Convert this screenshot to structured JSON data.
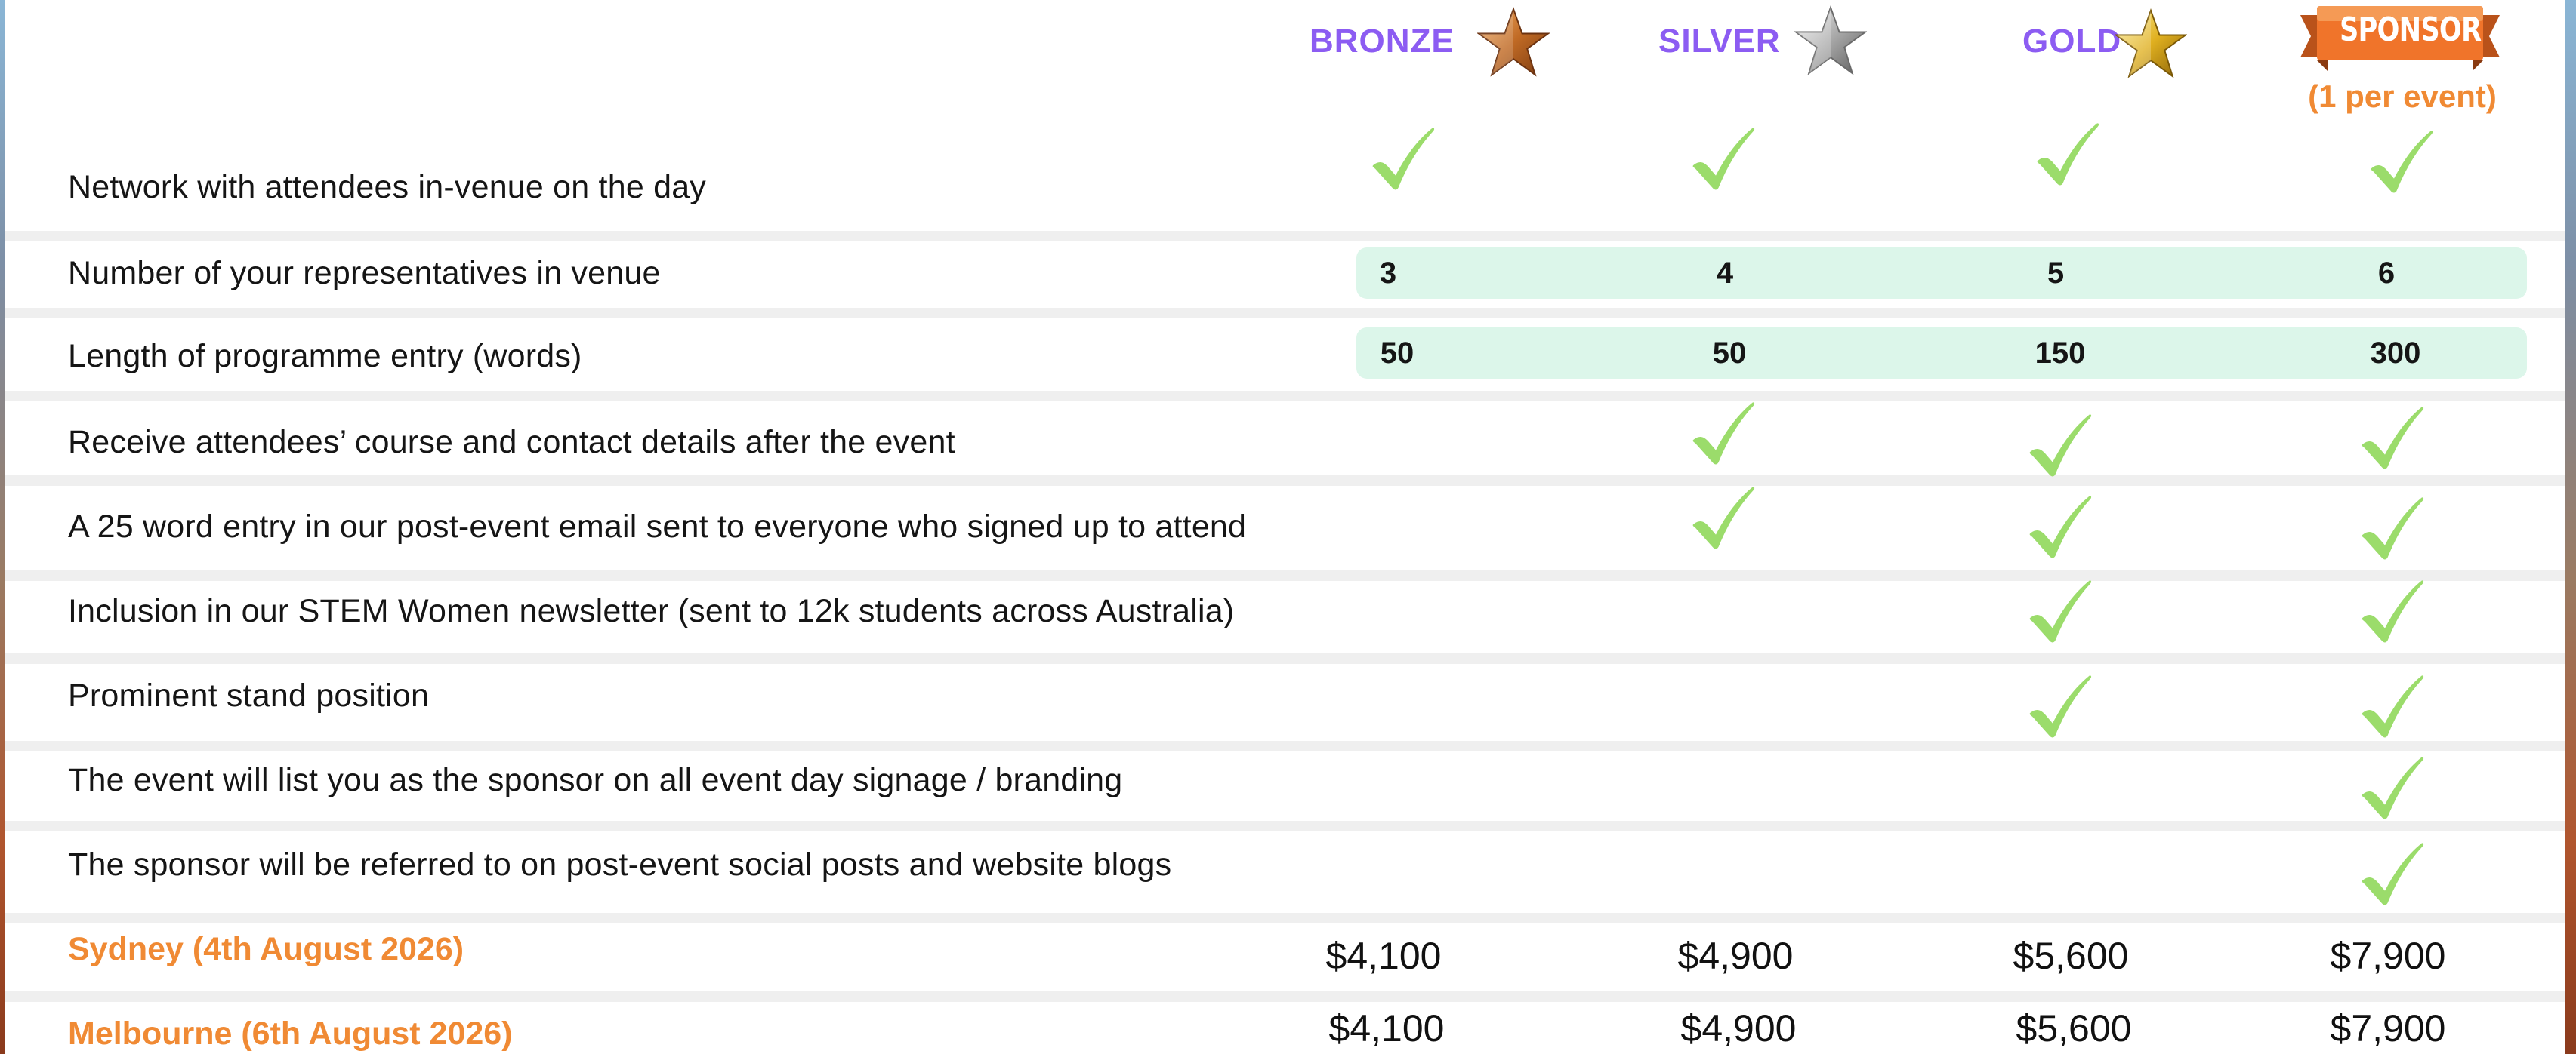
{
  "tiers": {
    "bronze": "BRONZE",
    "silver": "SILVER",
    "gold": "GOLD",
    "sponsor": "SPONSOR",
    "sponsor_note": "(1 per event)"
  },
  "features": [
    "Network with attendees in-venue on the day",
    "Number of your representatives in venue",
    "Length of programme entry (words)",
    "Receive attendees’ course and contact details after the event",
    "A 25 word entry in our post-event email sent to everyone who signed up to attend",
    "Inclusion in our STEM Women newsletter (sent to 12k students across Australia)",
    "Prominent stand position",
    "The event will list you as the sponsor on all event day signage / branding",
    "The sponsor will be referred to on post-event social posts and website blogs"
  ],
  "representatives": [
    "3",
    "4",
    "5",
    "6"
  ],
  "programme_words": [
    "50",
    "50",
    "150",
    "300"
  ],
  "cities": [
    {
      "name": "Sydney (4th August 2026)",
      "prices": [
        "$4,100",
        "$4,900",
        "$5,600",
        "$7,900"
      ]
    },
    {
      "name": "Melbourne (6th August 2026)",
      "prices": [
        "$4,100",
        "$4,900",
        "$5,600",
        "$7,900"
      ]
    }
  ],
  "colors": {
    "tier_heading": "#8c5cf2",
    "check": "#9bdc6b",
    "city": "#f08a34",
    "number_strip": "#dcf6ea",
    "sponsor_ribbon": "#f0742a"
  },
  "icons": {
    "bronze": "bronze-star-icon",
    "silver": "silver-star-icon",
    "gold": "gold-star-icon",
    "sponsor": "sponsor-ribbon-icon",
    "included": "checkmark-icon"
  }
}
